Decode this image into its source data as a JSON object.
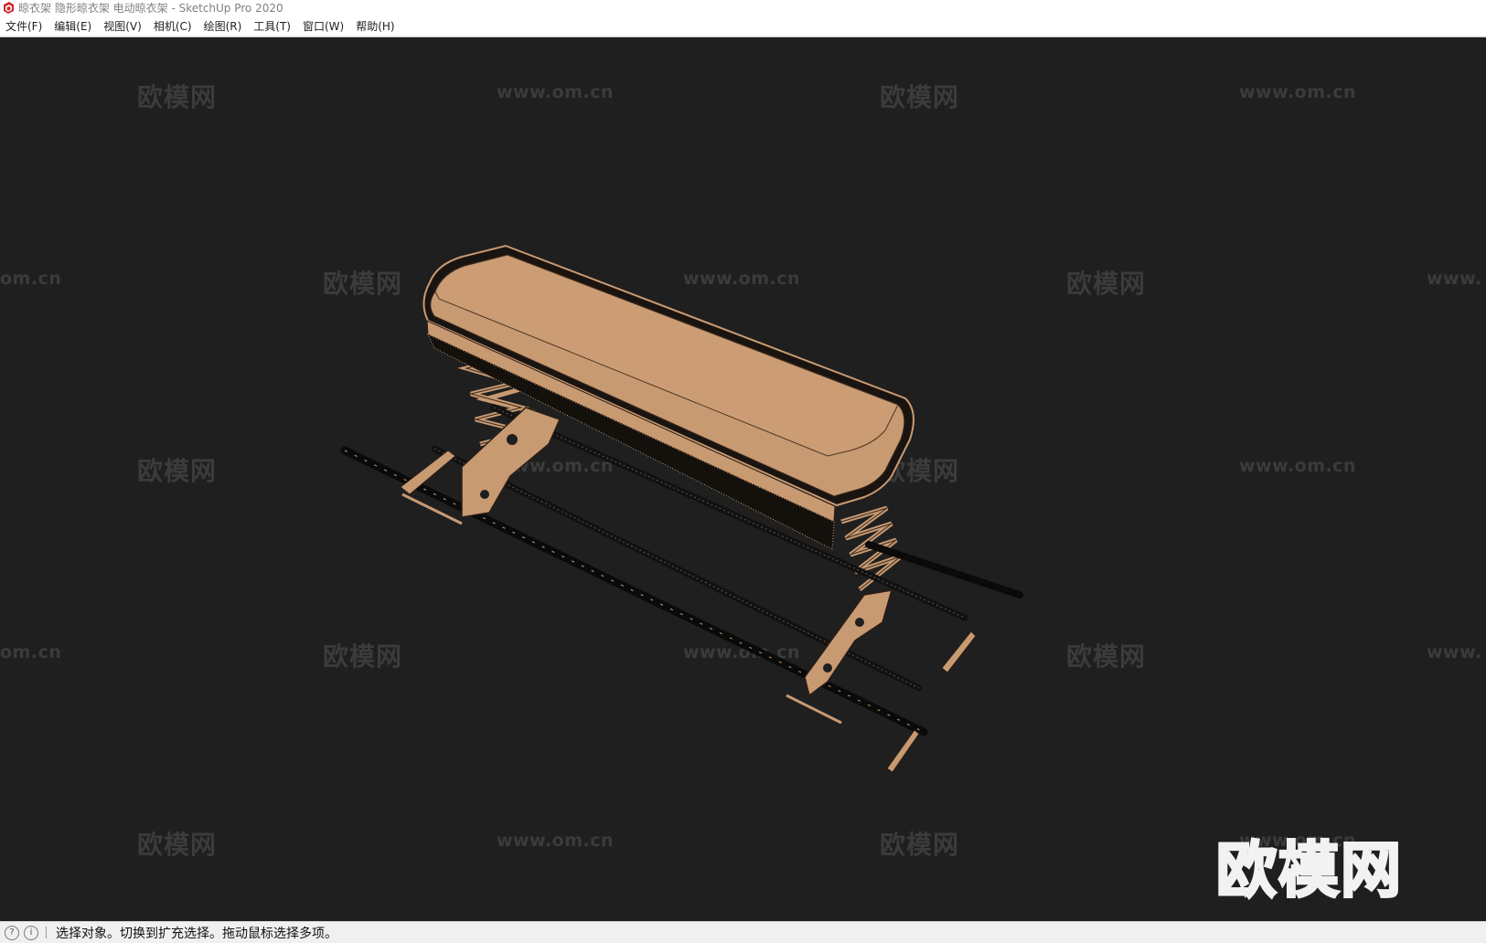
{
  "window": {
    "title": "晾衣架 隐形晾衣架 电动晾衣架 - SketchUp Pro 2020",
    "app_icon": "sketchup-icon"
  },
  "menubar": {
    "items": [
      {
        "label": "文件(F)"
      },
      {
        "label": "编辑(E)"
      },
      {
        "label": "视图(V)"
      },
      {
        "label": "相机(C)"
      },
      {
        "label": "绘图(R)"
      },
      {
        "label": "工具(T)"
      },
      {
        "label": "窗口(W)"
      },
      {
        "label": "帮助(H)"
      }
    ]
  },
  "watermark": {
    "cn": "欧模网",
    "url": "www.om.cn",
    "url_left": "om.cn",
    "url_right": "www."
  },
  "logo_watermark": "欧模网",
  "viewport": {
    "background": "#1f1f1f",
    "model_color": "#c89a72"
  },
  "statusbar": {
    "icon1": "geo-location-icon",
    "icon2": "info-icon",
    "text": "选择对象。切换到扩充选择。拖动鼠标选择多项。"
  }
}
